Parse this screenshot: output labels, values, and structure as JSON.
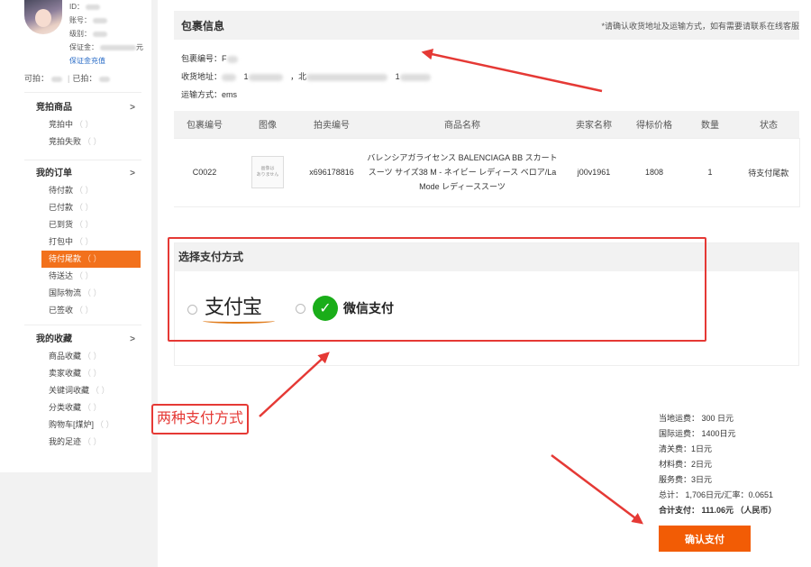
{
  "user": {
    "id_label": "ID：",
    "account_label": "账号：",
    "level_label": "级别：",
    "deposit_label": "保证金：",
    "deposit_suffix": "元",
    "recharge_link": "保证金充值",
    "can_bid_label": "可拍：",
    "bid_label": "已拍："
  },
  "sidebar": {
    "sections": [
      {
        "title": "竞拍商品",
        "items": [
          {
            "label": "竞拍中",
            "count": "（  ）"
          },
          {
            "label": "竞拍失败",
            "count": "（  ）"
          }
        ]
      },
      {
        "title": "我的订单",
        "items": [
          {
            "label": "待付款",
            "count": "（  ）"
          },
          {
            "label": "已付款",
            "count": "（  ）"
          },
          {
            "label": "已到货",
            "count": "（  ）"
          },
          {
            "label": "打包中",
            "count": "（  ）"
          },
          {
            "label": "待付尾款",
            "count": "（  ）",
            "active": true
          },
          {
            "label": "待送达",
            "count": "（  ）"
          },
          {
            "label": "国际物流",
            "count": "（  ）"
          },
          {
            "label": "已签收",
            "count": "（  ）"
          }
        ]
      },
      {
        "title": "我的收藏",
        "items": [
          {
            "label": "商品收藏",
            "count": "（  ）"
          },
          {
            "label": "卖家收藏",
            "count": "（  ）"
          },
          {
            "label": "关键词收藏",
            "count": "（  ）"
          },
          {
            "label": "分类收藏",
            "count": "（  ）"
          },
          {
            "label": "购物车[煤炉]",
            "count": "（  ）"
          },
          {
            "label": "我的足迹",
            "count": "（  ）"
          }
        ]
      }
    ],
    "chevron": ">"
  },
  "package": {
    "title": "包裹信息",
    "note": "*请确认收货地址及运输方式，如有需要请联系在线客服",
    "number_label": "包裹编号：",
    "number_value": "F",
    "address_label": "收货地址：",
    "address_part1": "1",
    "address_part2": "，北",
    "address_part3": "1",
    "shipping_label": "运输方式：",
    "shipping_value": "ems"
  },
  "table": {
    "headers": [
      "包裹编号",
      "图像",
      "拍卖编号",
      "商品名称",
      "卖家名称",
      "得标价格",
      "数量",
      "状态"
    ],
    "rows": [
      {
        "package_no": "C0022",
        "image_text": "画像は\nありません",
        "auction_no": "x696178816",
        "name": "バレンシアガライセンス BALENCIAGA BB スカートスーツ サイズ38 M - ネイビー レディース ベロア/La Mode レディーススーツ",
        "seller": "j00v1961",
        "price": "1808",
        "qty": "1",
        "status": "待支付尾款"
      }
    ]
  },
  "payment": {
    "title": "选择支付方式",
    "alipay_label": "支付宝",
    "wechat_label": "微信支付",
    "annotation_label": "两种支付方式"
  },
  "fees": {
    "local_shipping": "当地运费：  300 日元",
    "intl_shipping": "国际运费：  1400日元",
    "customs": "清关费：1日元",
    "material": "材料费：2日元",
    "service": "服务费：3日元",
    "subtotal": "总计：  1,706日元/汇率：0.0651",
    "total": "合计支付：  111.06元  （人民币）"
  },
  "actions": {
    "confirm_label": "确认支付"
  },
  "colors": {
    "accent": "#f25c05",
    "active_sidebar": "#f2711c",
    "annotation_red": "#e53935",
    "wechat_green": "#1aad19",
    "link_blue": "#2a6cc7"
  }
}
